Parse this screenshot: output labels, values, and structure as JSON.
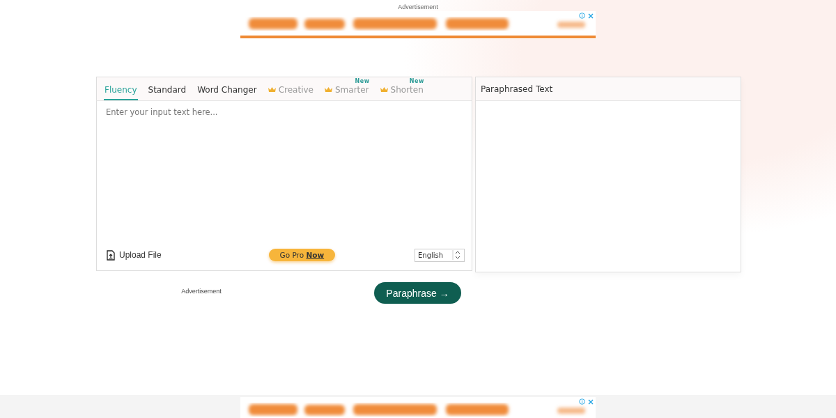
{
  "top_ad": {
    "label": "Advertisement",
    "kind": "picture"
  },
  "tabs": [
    {
      "label": "Fluency",
      "selected": true,
      "premium": false
    },
    {
      "label": "Standard",
      "selected": false,
      "premium": false
    },
    {
      "label": "Word Changer",
      "selected": false,
      "premium": false
    },
    {
      "label": "Creative",
      "selected": false,
      "premium": true
    },
    {
      "label": "Smarter",
      "selected": false,
      "premium": true,
      "badge": "New"
    },
    {
      "label": "Shorten",
      "selected": false,
      "premium": true,
      "badge": "New"
    }
  ],
  "input": {
    "placeholder": "Enter your input text here..."
  },
  "upload": {
    "label": "Upload File"
  },
  "go_pro": "Go Pro **Now**",
  "language": {
    "value": "English"
  },
  "output": {
    "title": "Paraphrased Text"
  },
  "side_ad": {
    "label": "Advertisement"
  },
  "paraphrase_button": "Paraphrase →"
}
